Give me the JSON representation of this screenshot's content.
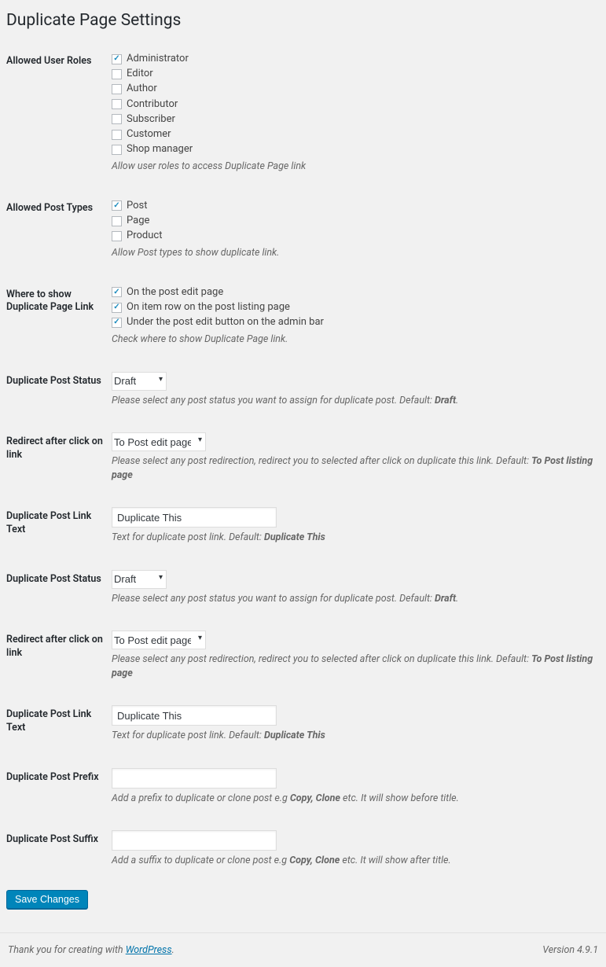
{
  "title": "Duplicate Page Settings",
  "rows": {
    "allowedUserRoles": {
      "label": "Allowed User Roles",
      "options": [
        {
          "label": "Administrator",
          "checked": true
        },
        {
          "label": "Editor",
          "checked": false
        },
        {
          "label": "Author",
          "checked": false
        },
        {
          "label": "Contributor",
          "checked": false
        },
        {
          "label": "Subscriber",
          "checked": false
        },
        {
          "label": "Customer",
          "checked": false
        },
        {
          "label": "Shop manager",
          "checked": false
        }
      ],
      "desc": "Allow user roles to access Duplicate Page link"
    },
    "allowedPostTypes": {
      "label": "Allowed Post Types",
      "options": [
        {
          "label": "Post",
          "checked": true
        },
        {
          "label": "Page",
          "checked": false
        },
        {
          "label": "Product",
          "checked": false
        }
      ],
      "desc": "Allow Post types to show duplicate link."
    },
    "whereToShow": {
      "label": "Where to show Duplicate Page Link",
      "options": [
        {
          "label": "On the post edit page",
          "checked": true
        },
        {
          "label": "On item row on the post listing page",
          "checked": true
        },
        {
          "label": "Under the post edit button on the admin bar",
          "checked": true
        }
      ],
      "desc": "Check where to show Duplicate Page link."
    },
    "status1": {
      "label": "Duplicate Post Status",
      "value": "Draft",
      "descPre": "Please select any post status you want to assign for duplicate post. Default: ",
      "descStrong": "Draft",
      "descPost": "."
    },
    "redirect1": {
      "label": "Redirect after click on link",
      "value": "To Post edit page",
      "descPre": "Please select any post redirection, redirect you to selected after click on duplicate this link. Default: ",
      "descStrong": "To Post listing page"
    },
    "linkText1": {
      "label": "Duplicate Post Link Text",
      "value": "Duplicate This",
      "descPre": "Text for duplicate post link. Default: ",
      "descStrong": "Duplicate This"
    },
    "status2": {
      "label": "Duplicate Post Status",
      "value": "Draft",
      "descPre": "Please select any post status you want to assign for duplicate post. Default: ",
      "descStrong": "Draft",
      "descPost": "."
    },
    "redirect2": {
      "label": "Redirect after click on link",
      "value": "To Post edit page",
      "descPre": "Please select any post redirection, redirect you to selected after click on duplicate this link. Default: ",
      "descStrong": "To Post listing page"
    },
    "linkText2": {
      "label": "Duplicate Post Link Text",
      "value": "Duplicate This",
      "descPre": "Text for duplicate post link. Default: ",
      "descStrong": "Duplicate This"
    },
    "prefix": {
      "label": "Duplicate Post Prefix",
      "value": "",
      "descPre": "Add a prefix to duplicate or clone post e.g ",
      "descStrong": "Copy, Clone",
      "descPost": " etc. It will show before title."
    },
    "suffix": {
      "label": "Duplicate Post Suffix",
      "value": "",
      "descPre": "Add a suffix to duplicate or clone post e.g ",
      "descStrong": "Copy, Clone",
      "descPost": " etc. It will show after title."
    }
  },
  "saveButton": "Save Changes",
  "footer": {
    "thankyou": "Thank you for creating with ",
    "link": "WordPress",
    "dot": ".",
    "version": "Version 4.9.1"
  }
}
